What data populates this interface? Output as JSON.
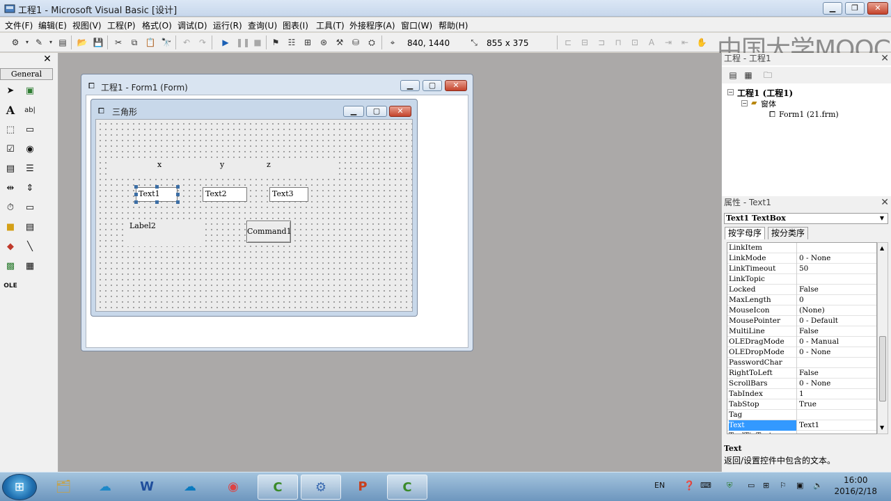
{
  "window": {
    "title": "工程1 - Microsoft Visual Basic [设计]"
  },
  "menu": [
    "文件(F)",
    "编辑(E)",
    "视图(V)",
    "工程(P)",
    "格式(O)",
    "调试(D)",
    "运行(R)",
    "查询(U)",
    "图表(I)",
    "工具(T)",
    "外接程序(A)",
    "窗口(W)",
    "帮助(H)"
  ],
  "toolbar": {
    "position": "840, 1440",
    "size": "855 x 375"
  },
  "watermark": "中国大学MOOC",
  "toolbox": {
    "tab_label": "General"
  },
  "form_window": {
    "title": "工程1 - Form1 (Form)"
  },
  "form": {
    "caption": "三角形",
    "labels": {
      "x": "x",
      "y": "y",
      "z": "z",
      "label2": "Label2"
    },
    "textboxes": [
      "Text1",
      "Text2",
      "Text3"
    ],
    "command": "Command1"
  },
  "project": {
    "title": "工程 - 工程1",
    "root": "工程1 (工程1)",
    "folder": "窗体",
    "file": "Form1 (21.frm)"
  },
  "properties": {
    "title": "属性 - Text1",
    "object": "Text1 TextBox",
    "tabs": [
      "按字母序",
      "按分类序"
    ],
    "rows": [
      {
        "name": "LinkItem",
        "value": ""
      },
      {
        "name": "LinkMode",
        "value": "0 - None"
      },
      {
        "name": "LinkTimeout",
        "value": "50"
      },
      {
        "name": "LinkTopic",
        "value": ""
      },
      {
        "name": "Locked",
        "value": "False"
      },
      {
        "name": "MaxLength",
        "value": "0"
      },
      {
        "name": "MouseIcon",
        "value": "(None)"
      },
      {
        "name": "MousePointer",
        "value": "0 - Default"
      },
      {
        "name": "MultiLine",
        "value": "False"
      },
      {
        "name": "OLEDragMode",
        "value": "0 - Manual"
      },
      {
        "name": "OLEDropMode",
        "value": "0 - None"
      },
      {
        "name": "PasswordChar",
        "value": ""
      },
      {
        "name": "RightToLeft",
        "value": "False"
      },
      {
        "name": "ScrollBars",
        "value": "0 - None"
      },
      {
        "name": "TabIndex",
        "value": "1"
      },
      {
        "name": "TabStop",
        "value": "True"
      },
      {
        "name": "Tag",
        "value": ""
      },
      {
        "name": "Text",
        "value": "Text1"
      },
      {
        "name": "ToolTipText",
        "value": ""
      }
    ],
    "description_title": "Text",
    "description": "返回/设置控件中包含的文本。"
  },
  "taskbar": {
    "lang": "EN",
    "time": "16:00",
    "date": "2016/2/18"
  },
  "colors": {
    "selection": "#3399ff",
    "close_button": "#c4442c",
    "workspace": "#aba9a8"
  }
}
